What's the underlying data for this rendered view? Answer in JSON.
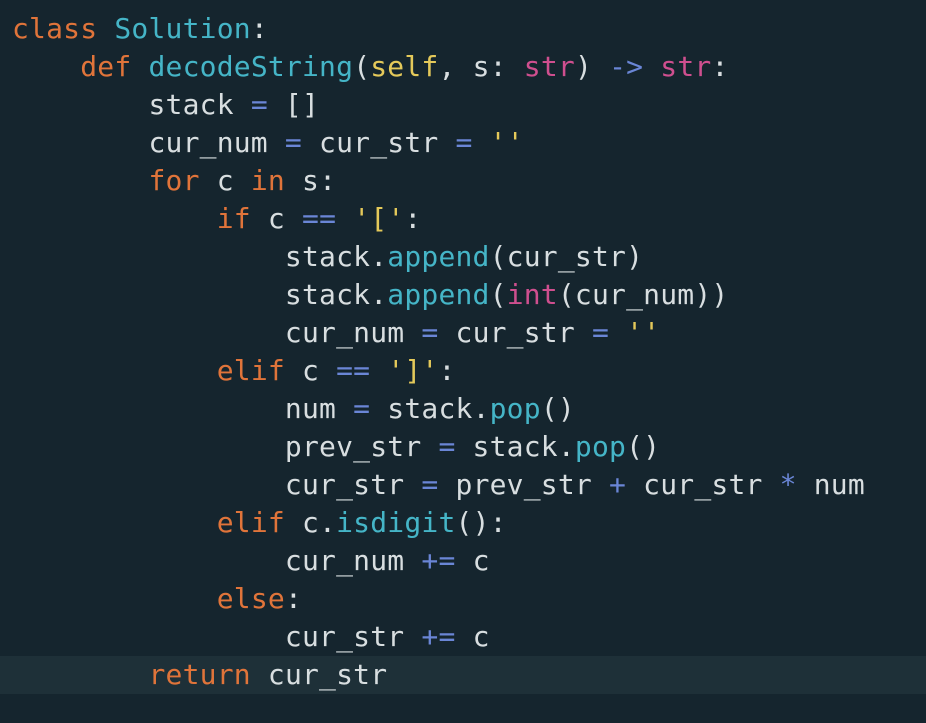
{
  "code_lines": [
    [
      {
        "t": "class",
        "c": "kw"
      },
      {
        "t": " ",
        "c": "pl"
      },
      {
        "t": "Solution",
        "c": "fn"
      },
      {
        "t": ":",
        "c": "pl"
      }
    ],
    [
      {
        "t": "    ",
        "c": "pl"
      },
      {
        "t": "def",
        "c": "kw"
      },
      {
        "t": " ",
        "c": "pl"
      },
      {
        "t": "decodeString",
        "c": "fn"
      },
      {
        "t": "(",
        "c": "pl"
      },
      {
        "t": "self",
        "c": "str"
      },
      {
        "t": ", s: ",
        "c": "pl"
      },
      {
        "t": "str",
        "c": "ty"
      },
      {
        "t": ") ",
        "c": "pl"
      },
      {
        "t": "->",
        "c": "op"
      },
      {
        "t": " ",
        "c": "pl"
      },
      {
        "t": "str",
        "c": "ty"
      },
      {
        "t": ":",
        "c": "pl"
      }
    ],
    [
      {
        "t": "        stack ",
        "c": "pl"
      },
      {
        "t": "=",
        "c": "op"
      },
      {
        "t": " []",
        "c": "pl"
      }
    ],
    [
      {
        "t": "        cur_num ",
        "c": "pl"
      },
      {
        "t": "=",
        "c": "op"
      },
      {
        "t": " cur_str ",
        "c": "pl"
      },
      {
        "t": "=",
        "c": "op"
      },
      {
        "t": " ",
        "c": "pl"
      },
      {
        "t": "''",
        "c": "str"
      }
    ],
    [
      {
        "t": "        ",
        "c": "pl"
      },
      {
        "t": "for",
        "c": "kw"
      },
      {
        "t": " c ",
        "c": "pl"
      },
      {
        "t": "in",
        "c": "kw"
      },
      {
        "t": " s:",
        "c": "pl"
      }
    ],
    [
      {
        "t": "            ",
        "c": "pl"
      },
      {
        "t": "if",
        "c": "kw"
      },
      {
        "t": " c ",
        "c": "pl"
      },
      {
        "t": "==",
        "c": "op"
      },
      {
        "t": " ",
        "c": "pl"
      },
      {
        "t": "'['",
        "c": "str"
      },
      {
        "t": ":",
        "c": "pl"
      }
    ],
    [
      {
        "t": "                stack.",
        "c": "pl"
      },
      {
        "t": "append",
        "c": "fn"
      },
      {
        "t": "(cur_str)",
        "c": "pl"
      }
    ],
    [
      {
        "t": "                stack.",
        "c": "pl"
      },
      {
        "t": "append",
        "c": "fn"
      },
      {
        "t": "(",
        "c": "pl"
      },
      {
        "t": "int",
        "c": "ty"
      },
      {
        "t": "(cur_num))",
        "c": "pl"
      }
    ],
    [
      {
        "t": "                cur_num ",
        "c": "pl"
      },
      {
        "t": "=",
        "c": "op"
      },
      {
        "t": " cur_str ",
        "c": "pl"
      },
      {
        "t": "=",
        "c": "op"
      },
      {
        "t": " ",
        "c": "pl"
      },
      {
        "t": "''",
        "c": "str"
      }
    ],
    [
      {
        "t": "            ",
        "c": "pl"
      },
      {
        "t": "elif",
        "c": "kw"
      },
      {
        "t": " c ",
        "c": "pl"
      },
      {
        "t": "==",
        "c": "op"
      },
      {
        "t": " ",
        "c": "pl"
      },
      {
        "t": "']'",
        "c": "str"
      },
      {
        "t": ":",
        "c": "pl"
      }
    ],
    [
      {
        "t": "                num ",
        "c": "pl"
      },
      {
        "t": "=",
        "c": "op"
      },
      {
        "t": " stack.",
        "c": "pl"
      },
      {
        "t": "pop",
        "c": "fn"
      },
      {
        "t": "()",
        "c": "pl"
      }
    ],
    [
      {
        "t": "                prev_str ",
        "c": "pl"
      },
      {
        "t": "=",
        "c": "op"
      },
      {
        "t": " stack.",
        "c": "pl"
      },
      {
        "t": "pop",
        "c": "fn"
      },
      {
        "t": "()",
        "c": "pl"
      }
    ],
    [
      {
        "t": "                cur_str ",
        "c": "pl"
      },
      {
        "t": "=",
        "c": "op"
      },
      {
        "t": " prev_str ",
        "c": "pl"
      },
      {
        "t": "+",
        "c": "op"
      },
      {
        "t": " cur_str ",
        "c": "pl"
      },
      {
        "t": "*",
        "c": "op"
      },
      {
        "t": " num",
        "c": "pl"
      }
    ],
    [
      {
        "t": "            ",
        "c": "pl"
      },
      {
        "t": "elif",
        "c": "kw"
      },
      {
        "t": " c.",
        "c": "pl"
      },
      {
        "t": "isdigit",
        "c": "fn"
      },
      {
        "t": "():",
        "c": "pl"
      }
    ],
    [
      {
        "t": "                cur_num ",
        "c": "pl"
      },
      {
        "t": "+=",
        "c": "op"
      },
      {
        "t": " c",
        "c": "pl"
      }
    ],
    [
      {
        "t": "            ",
        "c": "pl"
      },
      {
        "t": "else",
        "c": "kw"
      },
      {
        "t": ":",
        "c": "pl"
      }
    ],
    [
      {
        "t": "                cur_str ",
        "c": "pl"
      },
      {
        "t": "+=",
        "c": "op"
      },
      {
        "t": " c",
        "c": "pl"
      }
    ],
    [
      {
        "t": "        ",
        "c": "pl"
      },
      {
        "t": "return",
        "c": "kw"
      },
      {
        "t": " cur_str",
        "c": "pl"
      }
    ]
  ],
  "colors": {
    "background": "#15252e",
    "current_line": "#1e3038",
    "keyword": "#e0743a",
    "function": "#45b5c7",
    "type": "#cf4f8f",
    "operator": "#6a86d6",
    "string": "#e4c95a",
    "text": "#d8dee0"
  }
}
